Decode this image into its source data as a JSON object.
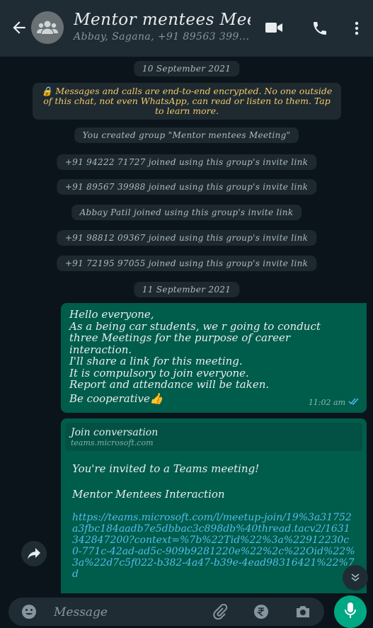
{
  "header": {
    "title": "Mentor mentees Mee...",
    "subtitle": "Abbay, Sagana, +91 89563 399..."
  },
  "chat": {
    "date_1": "10 September 2021",
    "encryption_notice": "Messages and calls are end-to-end encrypted. No one outside of this chat, not even WhatsApp, can read or listen to them. Tap to learn more.",
    "system_messages": [
      "You created group \"Mentor mentees Meeting\"",
      "+91 94222 71727 joined using this group's invite link",
      "+91 89567 39988 joined using this group's invite link",
      "Abbay Patil joined using this group's invite link",
      "+91 98812 09367 joined using this group's invite link",
      "+91 72195 97055 joined using this group's invite link"
    ],
    "date_2": "11 September 2021",
    "message_1": {
      "lines": [
        "Hello everyone,",
        "As a being car students, we r going to conduct",
        "three Meetings for the purpose of career",
        "interaction.",
        "I'll share a link for this meeting.",
        "It is compulsory to join everyone.",
        "Report and attendance will be taken.",
        "Be cooperative"
      ],
      "emoji": "👍",
      "time": "11:02 am"
    },
    "message_2": {
      "preview_title": "Join conversation",
      "preview_domain": "teams.microsoft.com",
      "invite_text": "You're invited to a Teams meeting!",
      "meeting_title": "Mentor Mentees Interaction",
      "link": "https://teams.microsoft.com/l/meetup-join/19%3a31752a3fbc184aadb7e5dbbac3c898db%40thread.tacv2/1631342847200?context=%7b%22Tid%22%3a%22912230c0-771c-42ad-ad5c-909b9281220e%22%2c%22Oid%22%3a%22d7c5f022-b382-4a47-b39e-4ead98316421%22%7d"
    }
  },
  "footer": {
    "placeholder": "Message"
  },
  "colors": {
    "header_bg": "#1f2c34",
    "chat_bg": "#0b141a",
    "outgoing_bubble": "#005c4b",
    "link": "#53bdeb",
    "encryption_text": "#f4c86b",
    "accent": "#00a884"
  },
  "icons": [
    "back-arrow-icon",
    "group-avatar-icon",
    "video-call-icon",
    "voice-call-icon",
    "more-options-icon",
    "double-check-icon",
    "share-icon",
    "scroll-down-icon",
    "emoji-icon",
    "attach-icon",
    "rupee-icon",
    "camera-icon",
    "mic-icon"
  ]
}
